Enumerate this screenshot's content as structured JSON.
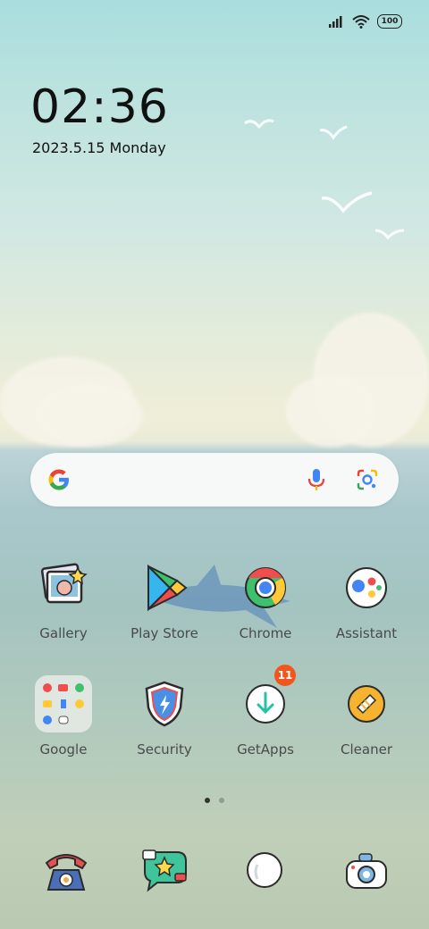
{
  "status": {
    "battery": "100",
    "icons": [
      "signal-icon",
      "wifi-icon",
      "battery-icon"
    ]
  },
  "clock": {
    "time": "02:36",
    "date": "2023.5.15 Monday"
  },
  "search": {
    "icons": [
      "google-g-icon",
      "mic-icon",
      "lens-icon"
    ]
  },
  "apps_row1": [
    {
      "label": "Gallery"
    },
    {
      "label": "Play Store"
    },
    {
      "label": "Chrome"
    },
    {
      "label": "Assistant"
    }
  ],
  "apps_row2": [
    {
      "label": "Google"
    },
    {
      "label": "Security"
    },
    {
      "label": "GetApps",
      "badge": "11"
    },
    {
      "label": "Cleaner"
    }
  ],
  "dock": [
    "phone-icon",
    "messages-icon",
    "browser-icon",
    "camera-icon"
  ],
  "colors": {
    "badge": "#f2561d",
    "google_blue": "#4285f4",
    "google_red": "#ea4335",
    "google_yellow": "#fbbc05",
    "google_green": "#34a853"
  }
}
